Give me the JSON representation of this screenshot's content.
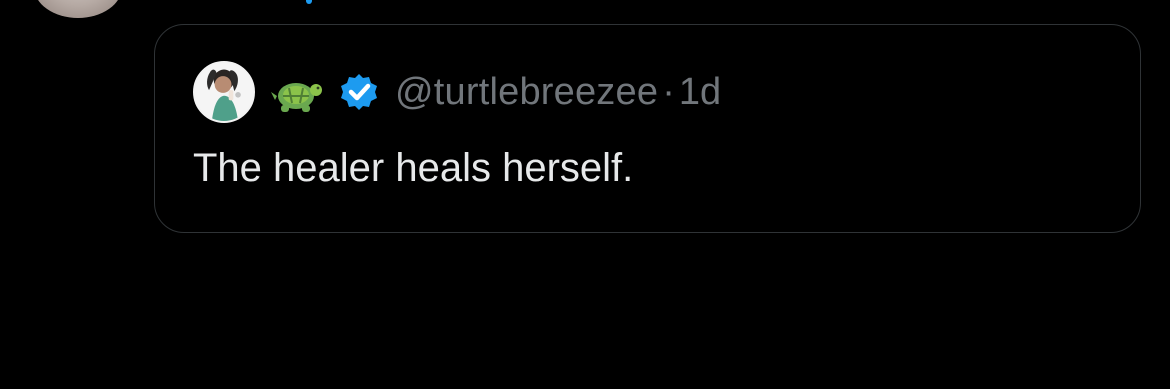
{
  "top_avatar": {
    "icon": "profile-photo"
  },
  "quoted_tweet": {
    "avatar": {
      "icon": "profile-photo"
    },
    "display_name_icon": "turtle-emoji",
    "verified_icon": "verified-badge",
    "handle": "@turtlebreezee",
    "separator": "·",
    "timestamp": "1d",
    "text": "The healer heals herself."
  },
  "colors": {
    "background": "#000000",
    "border": "#2f3336",
    "secondary_text": "#71767b",
    "primary_text": "#e7e9ea",
    "accent_blue": "#1d9bf0"
  }
}
